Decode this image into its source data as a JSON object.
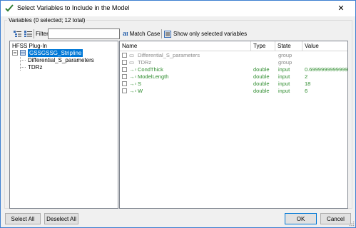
{
  "window": {
    "title": "Select Variables to Include in the Model",
    "close_glyph": "✕"
  },
  "group": {
    "label": "Variables (0 selected; 12 total)"
  },
  "toolbar": {
    "filter_label": "Filter:",
    "filter_value": "",
    "match_case_label": "Match Case",
    "show_selected_label": "Show only selected variables"
  },
  "tree": {
    "root": "HFSS Plug-In",
    "selected_node": "GSSGSSG_Stripline",
    "children": [
      "Differential_S_parameters",
      "TDRz"
    ]
  },
  "grid": {
    "columns": [
      "Name",
      "Type",
      "State",
      "Value"
    ],
    "rows": [
      {
        "name": "Differential_S_parameters",
        "type": "",
        "state": "group",
        "value": "",
        "kind": "group"
      },
      {
        "name": "TDRz",
        "type": "",
        "state": "group",
        "value": "",
        "kind": "group"
      },
      {
        "name": "CondThick",
        "type": "double",
        "state": "input",
        "value": "0.699999999999999",
        "kind": "input"
      },
      {
        "name": "ModelLength",
        "type": "double",
        "state": "input",
        "value": "2",
        "kind": "input"
      },
      {
        "name": "S",
        "type": "double",
        "state": "input",
        "value": "18",
        "kind": "input"
      },
      {
        "name": "W",
        "type": "double",
        "state": "input",
        "value": "6",
        "kind": "input"
      }
    ]
  },
  "buttons": {
    "select_all": "Select All",
    "deselect_all": "Deselect All",
    "ok": "OK",
    "cancel": "Cancel"
  },
  "colors": {
    "accent": "#0078d7",
    "input_green": "#2a8a2a",
    "group_gray": "#8a8a8a",
    "selection": "#0078d7"
  }
}
